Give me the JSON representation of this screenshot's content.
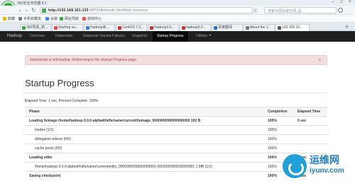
{
  "browser": {
    "window_title": "360安全浏览器 8.1",
    "url_host": "http://192.168.161.133",
    "url_path": ":9870/dfshealth.html#tab-overview",
    "url_right": "迅",
    "search_placeholder": "搜索本网站或全网_后",
    "bookmarks": [
      "收藏",
      "手机收藏夹",
      "谷歌",
      "网址导航",
      "游戏中心"
    ],
    "tabs": [
      "360导航_新...",
      "Starting na...",
      "Hadoop单...",
      "CentOS 7.2...",
      "Hadoop3.0...",
      "hadoop3.0...",
      "百度翻译",
      "About the 1...",
      "192.168.16..."
    ]
  },
  "hadoop_nav": {
    "brand": "Hadoop",
    "items": [
      "Overview",
      "Datanodes",
      "Datanode Volume Failures",
      "Snapshot",
      "Startup Progress",
      "Utilities"
    ]
  },
  "alert": {
    "message": "NameNode is still loading. Redirecting to the Startup Progress page.",
    "close": "×"
  },
  "page": {
    "title": "Startup Progress",
    "elapsed": "Elapsed Time: 1 sec, Percent Complete: 100%"
  },
  "table": {
    "headers": [
      "Phase",
      "Completion",
      "Elapsed Time"
    ],
    "rows": [
      {
        "phase": "Loading fsimage /home/hadoop-3.0.0-alpha4/hdfs/name/current/fsimage_0000000000000000000 332 B",
        "completion": "100%",
        "elapsed": "0 sec",
        "bold": true
      },
      {
        "phase": "inodes (1/1)",
        "completion": "100%",
        "elapsed": ""
      },
      {
        "phase": "delegation tokens (0/0)",
        "completion": "100%",
        "elapsed": ""
      },
      {
        "phase": "cache pools (0/0)",
        "completion": "100%",
        "elapsed": ""
      },
      {
        "phase": "Loading edits",
        "completion": "100%",
        "elapsed": "0 sec",
        "bold": true
      },
      {
        "phase": "/home/hadoop-3.0.0-alpha4/hdfs/name/current/edits_0000000000000000001-0000000000000000001 1 MB (1/1)",
        "completion": "100%",
        "elapsed": ""
      },
      {
        "phase": "Saving checkpoint",
        "completion": "100%",
        "elapsed": "0 sec",
        "bold": true
      }
    ]
  },
  "watermark": {
    "cn": "运维网",
    "url": "iyunv.com"
  },
  "colors": {
    "browser_green": "#2fae3c",
    "navbar": "#1f1f1f",
    "alert_bg": "#f2dede",
    "alert_text": "#a94442"
  }
}
